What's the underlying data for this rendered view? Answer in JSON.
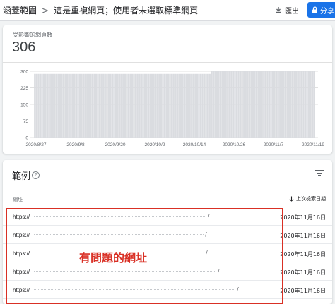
{
  "header": {
    "breadcrumb_root": "涵蓋範圍",
    "breadcrumb_sep": ">",
    "breadcrumb_current": "這是重複網頁；使用者未選取標準網頁",
    "export_label": "匯出",
    "share_label": "分享"
  },
  "metric": {
    "label": "受影響的網頁數",
    "value": "306"
  },
  "chart_data": {
    "type": "bar",
    "y_ticks": [
      "300",
      "225",
      "150",
      "75",
      "0"
    ],
    "ylim": [
      0,
      300
    ],
    "x_tick_labels": [
      "2020/8/27",
      "2020/9/8",
      "2020/9/20",
      "2020/10/2",
      "2020/10/14",
      "2020/10/26",
      "2020/11/7",
      "2020/11/19"
    ],
    "grid": true,
    "values": [
      288,
      288,
      288,
      288,
      288,
      288,
      288,
      288,
      288,
      288,
      288,
      288,
      288,
      288,
      288,
      288,
      288,
      288,
      288,
      288,
      288,
      288,
      288,
      288,
      288,
      288,
      288,
      288,
      288,
      288,
      288,
      288,
      288,
      288,
      288,
      288,
      288,
      288,
      288,
      288,
      288,
      288,
      288,
      288,
      288,
      288,
      288,
      288,
      288,
      288,
      288,
      288,
      288,
      288,
      288,
      288,
      288,
      288,
      288,
      288,
      288,
      288,
      288,
      288,
      288,
      288,
      288,
      288,
      288,
      288,
      288,
      288,
      288,
      288,
      288,
      288,
      288,
      288,
      288,
      288,
      288,
      288,
      288,
      288,
      288,
      288,
      288,
      288,
      288,
      288,
      288,
      288,
      288,
      288,
      288,
      288,
      288,
      288,
      300,
      300,
      300,
      300,
      300,
      300,
      300,
      300,
      300,
      300,
      300,
      300,
      300,
      300,
      300,
      300,
      300,
      300,
      300,
      300,
      300,
      300,
      300,
      300,
      300,
      300,
      300,
      300,
      300,
      300,
      300,
      300,
      300,
      300,
      300,
      300,
      300,
      300,
      300,
      300,
      300,
      300,
      300,
      300,
      300,
      300,
      300,
      300,
      300,
      300,
      300,
      300,
      300,
      300,
      300,
      300,
      300,
      300
    ],
    "bar_color": "#dadce0"
  },
  "examples": {
    "title": "範例",
    "col_url": "網址",
    "col_date": "上次檢索日期",
    "annotation": "有問題的網址",
    "rows": [
      {
        "url_prefix": "https://",
        "date": "2020年11月16日"
      },
      {
        "url_prefix": "https://",
        "date": "2020年11月16日"
      },
      {
        "url_prefix": "https://",
        "date": "2020年11月16日"
      },
      {
        "url_prefix": "https://",
        "date": "2020年11月16日"
      },
      {
        "url_prefix": "https://",
        "date": "2020年11月16日"
      }
    ]
  },
  "colors": {
    "accent": "#1a73e8",
    "annotation_red": "#d93025"
  }
}
